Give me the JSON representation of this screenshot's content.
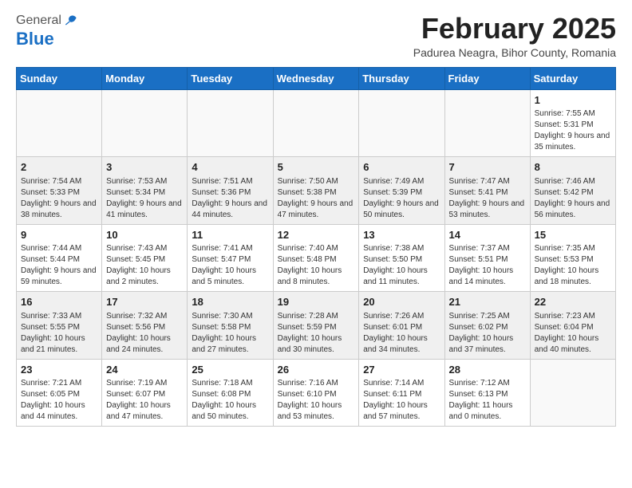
{
  "header": {
    "logo_general": "General",
    "logo_blue": "Blue",
    "month_title": "February 2025",
    "subtitle": "Padurea Neagra, Bihor County, Romania"
  },
  "weekdays": [
    "Sunday",
    "Monday",
    "Tuesday",
    "Wednesday",
    "Thursday",
    "Friday",
    "Saturday"
  ],
  "weeks": [
    [
      {
        "day": "",
        "info": ""
      },
      {
        "day": "",
        "info": ""
      },
      {
        "day": "",
        "info": ""
      },
      {
        "day": "",
        "info": ""
      },
      {
        "day": "",
        "info": ""
      },
      {
        "day": "",
        "info": ""
      },
      {
        "day": "1",
        "info": "Sunrise: 7:55 AM\nSunset: 5:31 PM\nDaylight: 9 hours and 35 minutes."
      }
    ],
    [
      {
        "day": "2",
        "info": "Sunrise: 7:54 AM\nSunset: 5:33 PM\nDaylight: 9 hours and 38 minutes."
      },
      {
        "day": "3",
        "info": "Sunrise: 7:53 AM\nSunset: 5:34 PM\nDaylight: 9 hours and 41 minutes."
      },
      {
        "day": "4",
        "info": "Sunrise: 7:51 AM\nSunset: 5:36 PM\nDaylight: 9 hours and 44 minutes."
      },
      {
        "day": "5",
        "info": "Sunrise: 7:50 AM\nSunset: 5:38 PM\nDaylight: 9 hours and 47 minutes."
      },
      {
        "day": "6",
        "info": "Sunrise: 7:49 AM\nSunset: 5:39 PM\nDaylight: 9 hours and 50 minutes."
      },
      {
        "day": "7",
        "info": "Sunrise: 7:47 AM\nSunset: 5:41 PM\nDaylight: 9 hours and 53 minutes."
      },
      {
        "day": "8",
        "info": "Sunrise: 7:46 AM\nSunset: 5:42 PM\nDaylight: 9 hours and 56 minutes."
      }
    ],
    [
      {
        "day": "9",
        "info": "Sunrise: 7:44 AM\nSunset: 5:44 PM\nDaylight: 9 hours and 59 minutes."
      },
      {
        "day": "10",
        "info": "Sunrise: 7:43 AM\nSunset: 5:45 PM\nDaylight: 10 hours and 2 minutes."
      },
      {
        "day": "11",
        "info": "Sunrise: 7:41 AM\nSunset: 5:47 PM\nDaylight: 10 hours and 5 minutes."
      },
      {
        "day": "12",
        "info": "Sunrise: 7:40 AM\nSunset: 5:48 PM\nDaylight: 10 hours and 8 minutes."
      },
      {
        "day": "13",
        "info": "Sunrise: 7:38 AM\nSunset: 5:50 PM\nDaylight: 10 hours and 11 minutes."
      },
      {
        "day": "14",
        "info": "Sunrise: 7:37 AM\nSunset: 5:51 PM\nDaylight: 10 hours and 14 minutes."
      },
      {
        "day": "15",
        "info": "Sunrise: 7:35 AM\nSunset: 5:53 PM\nDaylight: 10 hours and 18 minutes."
      }
    ],
    [
      {
        "day": "16",
        "info": "Sunrise: 7:33 AM\nSunset: 5:55 PM\nDaylight: 10 hours and 21 minutes."
      },
      {
        "day": "17",
        "info": "Sunrise: 7:32 AM\nSunset: 5:56 PM\nDaylight: 10 hours and 24 minutes."
      },
      {
        "day": "18",
        "info": "Sunrise: 7:30 AM\nSunset: 5:58 PM\nDaylight: 10 hours and 27 minutes."
      },
      {
        "day": "19",
        "info": "Sunrise: 7:28 AM\nSunset: 5:59 PM\nDaylight: 10 hours and 30 minutes."
      },
      {
        "day": "20",
        "info": "Sunrise: 7:26 AM\nSunset: 6:01 PM\nDaylight: 10 hours and 34 minutes."
      },
      {
        "day": "21",
        "info": "Sunrise: 7:25 AM\nSunset: 6:02 PM\nDaylight: 10 hours and 37 minutes."
      },
      {
        "day": "22",
        "info": "Sunrise: 7:23 AM\nSunset: 6:04 PM\nDaylight: 10 hours and 40 minutes."
      }
    ],
    [
      {
        "day": "23",
        "info": "Sunrise: 7:21 AM\nSunset: 6:05 PM\nDaylight: 10 hours and 44 minutes."
      },
      {
        "day": "24",
        "info": "Sunrise: 7:19 AM\nSunset: 6:07 PM\nDaylight: 10 hours and 47 minutes."
      },
      {
        "day": "25",
        "info": "Sunrise: 7:18 AM\nSunset: 6:08 PM\nDaylight: 10 hours and 50 minutes."
      },
      {
        "day": "26",
        "info": "Sunrise: 7:16 AM\nSunset: 6:10 PM\nDaylight: 10 hours and 53 minutes."
      },
      {
        "day": "27",
        "info": "Sunrise: 7:14 AM\nSunset: 6:11 PM\nDaylight: 10 hours and 57 minutes."
      },
      {
        "day": "28",
        "info": "Sunrise: 7:12 AM\nSunset: 6:13 PM\nDaylight: 11 hours and 0 minutes."
      },
      {
        "day": "",
        "info": ""
      }
    ]
  ]
}
